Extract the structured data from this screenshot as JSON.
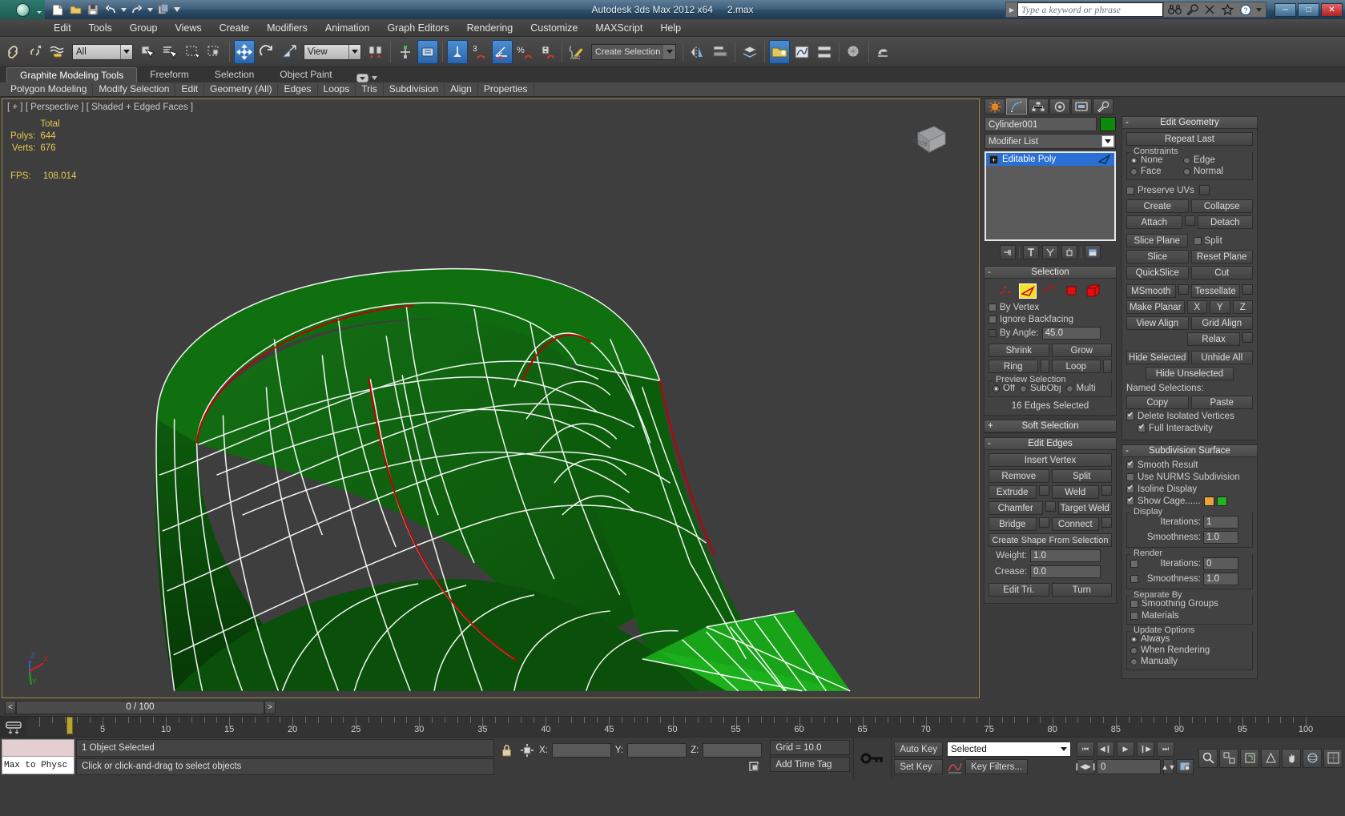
{
  "titlebar": {
    "app_title": "Autodesk 3ds Max  2012 x64",
    "file_name": "2.max",
    "search_placeholder": "Type a keyword or phrase",
    "quick_access": [
      "new-icon",
      "open-icon",
      "save-icon",
      "undo-icon",
      "redo-icon",
      "set-project-icon"
    ],
    "help_icons": [
      "binoculars-icon",
      "wrench-icon",
      "satellite-icon",
      "star-icon",
      "help-icon"
    ],
    "window_buttons": [
      "minimize",
      "maximize",
      "close"
    ]
  },
  "menu": {
    "items": [
      "Edit",
      "Tools",
      "Group",
      "Views",
      "Create",
      "Modifiers",
      "Animation",
      "Graph Editors",
      "Rendering",
      "Customize",
      "MAXScript",
      "Help"
    ]
  },
  "toolbar": {
    "selection_filter": "All",
    "reference_coord": "View",
    "named_selection_set": "Create Selection Se",
    "icons": [
      "undo-scene-icon",
      "redo-scene-icon",
      "select-link-icon",
      "unlink-icon",
      "bind-space-warp-icon",
      "select-object-icon",
      "select-by-name-icon",
      "rectangular-region-icon",
      "window-crossing-icon",
      "select-and-move-icon",
      "select-and-rotate-icon",
      "select-and-scale-icon",
      "use-pivot-center-icon",
      "select-and-manipulate-icon",
      "snap-toggle-icon",
      "angle-snap-icon",
      "percent-snap-icon",
      "spinner-snap-icon",
      "edit-named-selection-icon",
      "mirror-icon",
      "align-icon",
      "layer-manager-icon",
      "graphite-toggle-icon",
      "curve-editor-icon",
      "schematic-view-icon",
      "material-editor-icon",
      "render-setup-icon"
    ]
  },
  "ribbon": {
    "tabs": [
      "Graphite Modeling Tools",
      "Freeform",
      "Selection",
      "Object Paint"
    ],
    "active_tab": "Graphite Modeling Tools",
    "panels": [
      "Polygon Modeling",
      "Modify Selection",
      "Edit",
      "Geometry (All)",
      "Edges",
      "Loops",
      "Tris",
      "Subdivision",
      "Align",
      "Properties"
    ]
  },
  "viewport": {
    "label": "[ + ] [ Perspective ] [ Shaded + Edged Faces ]",
    "stats_header": "Total",
    "stats": [
      {
        "label": "Polys:",
        "value": "644"
      },
      {
        "label": "Verts:",
        "value": "676"
      }
    ],
    "fps_label": "FPS:",
    "fps_value": "108.014",
    "viewcube_face": "BOTTOM",
    "axis_labels": [
      "Z",
      "X",
      "Y"
    ],
    "mesh_color": "#147014",
    "wire_color": "#ffffff",
    "selected_edge_color": "#c00000",
    "background_color": "#3e3e3e"
  },
  "command_panel": {
    "tabs": [
      "create-tab-icon",
      "modify-tab-icon",
      "hierarchy-tab-icon",
      "motion-tab-icon",
      "display-tab-icon",
      "utilities-tab-icon"
    ],
    "active_tab_index": 1,
    "object_name": "Cylinder001",
    "object_color": "#0c8a0c",
    "modifier_list_label": "Modifier List",
    "stack": [
      {
        "label": "Editable Poly",
        "selected": true
      }
    ],
    "selection": {
      "title": "Selection",
      "sub_object_icons": [
        "vertex-icon",
        "edge-icon",
        "border-icon",
        "polygon-icon",
        "element-icon"
      ],
      "active_sub_object": "edge-icon",
      "checkboxes": [
        {
          "label": "By Vertex",
          "checked": false
        },
        {
          "label": "Ignore Backfacing",
          "checked": false
        },
        {
          "label": "By Angle:",
          "checked": false
        }
      ],
      "by_angle_value": "45.0",
      "buttons": [
        "Shrink",
        "Grow",
        "Ring",
        "Loop"
      ],
      "preview_group": "Preview Selection",
      "preview_options": [
        "Off",
        "SubObj",
        "Multi"
      ],
      "preview_selected": "Off",
      "status": "16 Edges Selected"
    },
    "soft_selection": {
      "title": "Soft Selection"
    },
    "edit_edges": {
      "title": "Edit Edges",
      "insert_vertex": "Insert Vertex",
      "buttons": [
        [
          "Remove",
          "Split"
        ],
        [
          "Extrude",
          "Weld"
        ],
        [
          "Chamfer",
          "Target Weld"
        ],
        [
          "Bridge",
          "Connect"
        ]
      ],
      "create_shape": "Create Shape From Selection",
      "weight_label": "Weight:",
      "weight_value": "1.0",
      "crease_label": "Crease:",
      "crease_value": "0.0",
      "edit_tri": "Edit Tri.",
      "turn": "Turn"
    },
    "edit_geometry": {
      "title": "Edit Geometry",
      "repeat_last": "Repeat Last",
      "constraints_label": "Constraints",
      "constraints": [
        "None",
        "Edge",
        "Face",
        "Normal"
      ],
      "constraint_selected": "None",
      "preserve_uvs": "Preserve UVs",
      "preserve_uvs_checked": false,
      "buttons": [
        [
          "Create",
          "Collapse"
        ],
        [
          "Attach",
          "Detach"
        ],
        [
          "Slice Plane",
          "Split"
        ],
        [
          "Slice",
          "Reset Plane"
        ],
        [
          "QuickSlice",
          "Cut"
        ],
        [
          "MSmooth",
          "Tessellate"
        ],
        [
          "Make Planar",
          "X",
          "Y",
          "Z"
        ],
        [
          "View Align",
          "Grid Align"
        ],
        [
          "Relax"
        ],
        [
          "Hide Selected",
          "Unhide All"
        ],
        [
          "Hide Unselected"
        ]
      ],
      "split_checked": false,
      "named_selections_label": "Named Selections:",
      "copy": "Copy",
      "paste": "Paste",
      "delete_isolated": "Delete Isolated Vertices",
      "delete_isolated_checked": true,
      "full_interactivity": "Full Interactivity",
      "full_interactivity_checked": true
    },
    "subdivision_surface": {
      "title": "Subdivision Surface",
      "checkboxes": [
        {
          "label": "Smooth Result",
          "checked": true
        },
        {
          "label": "Use NURMS Subdivision",
          "checked": false
        },
        {
          "label": "Isoline Display",
          "checked": true
        },
        {
          "label": "Show Cage......",
          "checked": true
        }
      ],
      "cage_color_1": "#e8a33d",
      "cage_color_2": "#22b222",
      "display_group": "Display",
      "display_iterations_label": "Iterations:",
      "display_iterations_value": "1",
      "display_smoothness_label": "Smoothness:",
      "display_smoothness_value": "1.0",
      "render_group": "Render",
      "render_iterations_label": "Iterations:",
      "render_iterations_value": "0",
      "render_iterations_checked": false,
      "render_smoothness_label": "Smoothness:",
      "render_smoothness_value": "1.0",
      "render_smoothness_checked": false,
      "separate_by_group": "Separate By",
      "separate_by": [
        {
          "label": "Smoothing Groups",
          "checked": false
        },
        {
          "label": "Materials",
          "checked": false
        }
      ],
      "update_options_group": "Update Options",
      "update_options": [
        "Always",
        "When Rendering",
        "Manually"
      ],
      "update_selected": "Always"
    }
  },
  "time_slider": {
    "current": "0 / 100",
    "prev_label": "<",
    "next_label": ">",
    "ticks": [
      "5",
      "10",
      "15",
      "20",
      "25",
      "30",
      "35",
      "40",
      "45",
      "50",
      "55",
      "60",
      "65",
      "70",
      "75",
      "80",
      "85",
      "90",
      "95",
      "100"
    ]
  },
  "status_bar": {
    "max_to_physx": "Max to Physc",
    "object_selected": "1 Object Selected",
    "prompt": "Click or click-and-drag to select objects",
    "coord_labels": [
      "X:",
      "Y:",
      "Z:"
    ],
    "coord_values": [
      "",
      "",
      ""
    ],
    "grid": "Grid = 10.0",
    "add_time_tag": "Add Time Tag",
    "auto_key": "Auto Key",
    "set_key": "Set Key",
    "key_mode": "Selected",
    "key_filters": "Key Filters...",
    "frame_field": "0",
    "nav_buttons": [
      "go-to-start-icon",
      "previous-frame-icon",
      "play-icon",
      "next-frame-icon",
      "go-to-end-icon"
    ]
  }
}
